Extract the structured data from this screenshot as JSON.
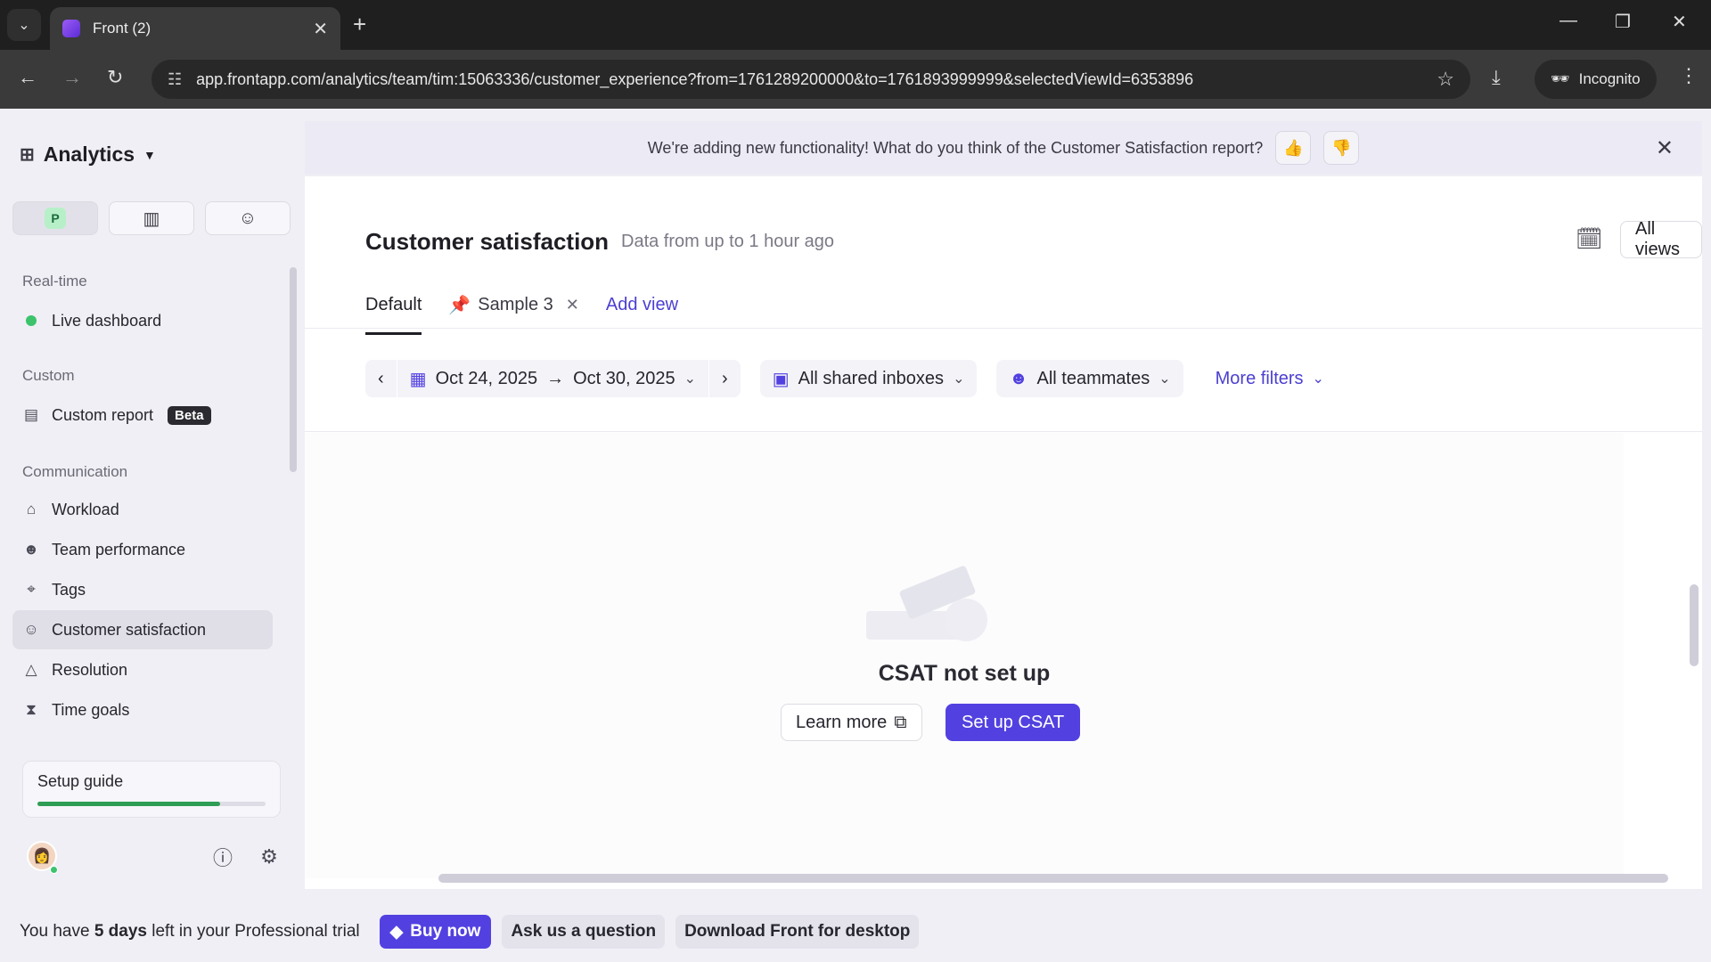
{
  "browser": {
    "tab_title": "Front (2)",
    "url": "app.frontapp.com/analytics/team/tim:15063336/customer_experience?from=1761289200000&to=1761893999999&selectedViewId=6353896",
    "incognito_label": "Incognito"
  },
  "sidebar": {
    "app_title": "Analytics",
    "switcher_badge": "P",
    "sections": {
      "realtime": "Real-time",
      "custom": "Custom",
      "communication": "Communication"
    },
    "items": {
      "live_dashboard": "Live dashboard",
      "custom_report": "Custom report",
      "custom_report_badge": "Beta",
      "workload": "Workload",
      "team_performance": "Team performance",
      "tags": "Tags",
      "customer_satisfaction": "Customer satisfaction",
      "resolution": "Resolution",
      "time_goals": "Time goals"
    },
    "setup_guide": {
      "label": "Setup guide",
      "progress": 0.8
    }
  },
  "banner": {
    "text": "We're adding new functionality! What do you think of the Customer Satisfaction report?"
  },
  "header": {
    "title": "Customer satisfaction",
    "subtitle": "Data from up to 1 hour ago",
    "all_views_label": "All views"
  },
  "view_tabs": {
    "default": "Default",
    "sample": "Sample 3",
    "add_view": "Add view"
  },
  "filters": {
    "date_from": "Oct 24, 2025",
    "date_to": "Oct 30, 2025",
    "arrow": "→",
    "inboxes": "All shared inboxes",
    "teammates": "All teammates",
    "more_filters": "More filters"
  },
  "empty_state": {
    "title": "CSAT not set up",
    "learn_more": "Learn more",
    "setup": "Set up CSAT"
  },
  "trial": {
    "prefix": "You have ",
    "days": "5 days",
    "suffix": " left in your Professional trial",
    "buy": "Buy now",
    "ask": "Ask us a question",
    "download": "Download Front for desktop"
  },
  "colors": {
    "accent": "#5241e0",
    "success": "#3cc36c"
  }
}
